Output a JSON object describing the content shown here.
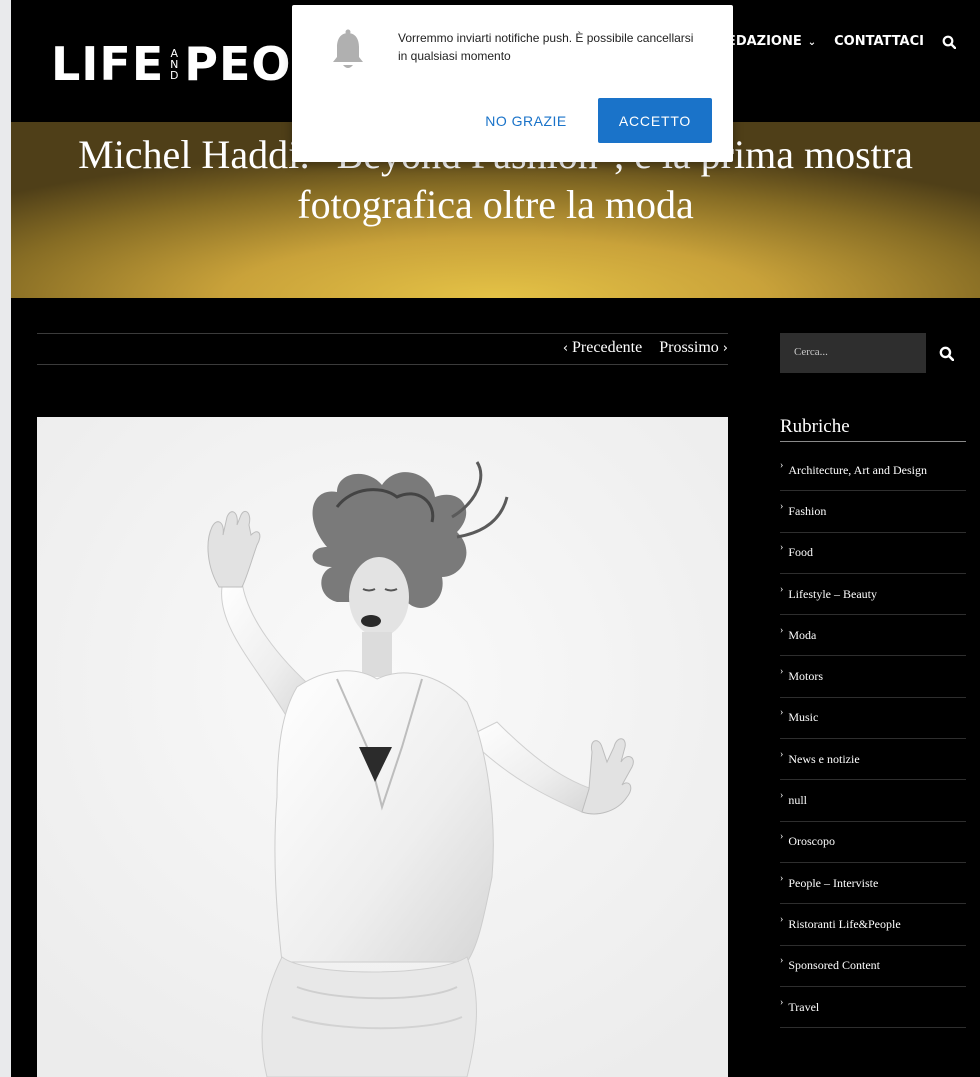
{
  "popup": {
    "message": "Vorremmo inviarti notifiche push. È possibile cancellarsi in qualsiasi momento",
    "decline": "NO GRAZIE",
    "accept": "ACCETTO",
    "icon": "bell-icon"
  },
  "header": {
    "logo_left": "LIFE",
    "logo_and": [
      "A",
      "N",
      "D"
    ],
    "logo_right": "PEO",
    "nav": [
      {
        "label": "REDAZIONE",
        "has_dropdown": true
      },
      {
        "label": "CONTATTACI",
        "has_dropdown": false
      }
    ],
    "search_icon": "search-icon"
  },
  "hero": {
    "title": "Michel Haddi: \"Beyond Fashion\", è la prima mostra fotografica oltre la moda"
  },
  "post_nav": {
    "prev": "Precedente",
    "next": "Prossimo"
  },
  "sidebar": {
    "search_placeholder": "Cerca...",
    "rubriche_title": "Rubriche",
    "categories": [
      "Architecture, Art and Design",
      "Fashion",
      "Food",
      "Lifestyle – Beauty",
      "Moda",
      "Motors",
      "Music",
      "News e notizie",
      "null",
      "Oroscopo",
      "People – Interviste",
      "Ristoranti Life&People",
      "Sponsored Content",
      "Travel"
    ]
  },
  "colors": {
    "accent_blue": "#1a73c9",
    "gold": "#d4b040",
    "background": "#000000"
  }
}
